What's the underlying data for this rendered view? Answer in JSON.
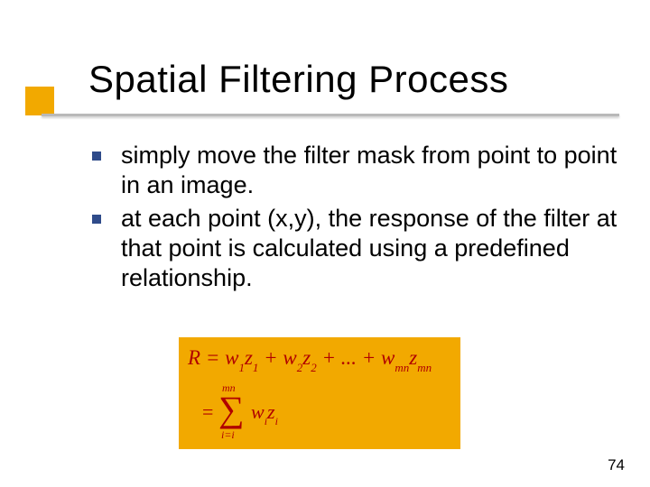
{
  "title": "Spatial Filtering Process",
  "bullets": [
    "simply move the filter mask from point to point in an image.",
    "at each point (x,y), the response of the filter at that point is calculated using a predefined relationship."
  ],
  "formula": {
    "line1_sequence": [
      {
        "t": "R",
        "sub": ""
      },
      {
        "t": " = ",
        "sub": ""
      },
      {
        "t": "w",
        "sub": "1"
      },
      {
        "t": "z",
        "sub": "1"
      },
      {
        "t": " + ",
        "sub": ""
      },
      {
        "t": "w",
        "sub": "2"
      },
      {
        "t": "z",
        "sub": "2"
      },
      {
        "t": " + ... + ",
        "sub": ""
      },
      {
        "t": "w",
        "sub": "mn"
      },
      {
        "t": "z",
        "sub": "mn"
      }
    ],
    "eq_sign": "=",
    "sigma_upper": "mn",
    "sigma_lower": "i=i",
    "summand": [
      {
        "t": "w",
        "sub": "i"
      },
      {
        "t": "z",
        "sub": "i"
      }
    ]
  },
  "page_number": "74",
  "colors": {
    "accent_orange": "#f2a900",
    "bullet_blue": "#2f4b8a",
    "formula_text": "#b00000"
  }
}
